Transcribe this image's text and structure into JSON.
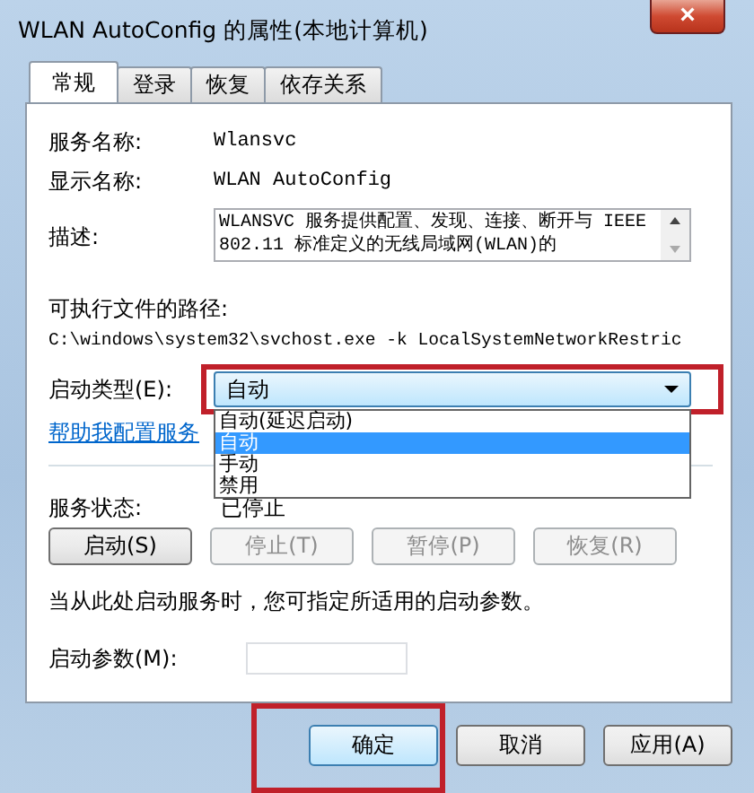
{
  "window": {
    "title": "WLAN AutoConfig 的属性(本地计算机)",
    "close": "×"
  },
  "tabs": [
    {
      "label": "常规",
      "selected": true
    },
    {
      "label": "登录",
      "selected": false
    },
    {
      "label": "恢复",
      "selected": false
    },
    {
      "label": "依存关系",
      "selected": false
    }
  ],
  "service_name": {
    "label": "服务名称:",
    "value": "Wlansvc"
  },
  "display_name": {
    "label": "显示名称:",
    "value": "WLAN AutoConfig"
  },
  "description": {
    "label": "描述:",
    "value": "WLANSVC 服务提供配置、发现、连接、断开与 IEEE 802.11 标准定义的无线局域网(WLAN)的"
  },
  "executable_path": {
    "label": "可执行文件的路径:",
    "value": "C:\\windows\\system32\\svchost.exe -k LocalSystemNetworkRestric"
  },
  "startup_type": {
    "label": "启动类型(E):",
    "value": "自动",
    "highlighted": true,
    "expanded": true,
    "options": [
      {
        "label": "自动(延迟启动)",
        "selected": false
      },
      {
        "label": "自动",
        "selected": true
      },
      {
        "label": "手动",
        "selected": false
      },
      {
        "label": "禁用",
        "selected": false
      }
    ]
  },
  "help_link": "帮助我配置服务",
  "service_status": {
    "label": "服务状态:",
    "value": "已停止"
  },
  "service_buttons": [
    {
      "label": "启动(S)",
      "disabled": false
    },
    {
      "label": "停止(T)",
      "disabled": true
    },
    {
      "label": "暂停(P)",
      "disabled": true
    },
    {
      "label": "恢复(R)",
      "disabled": true
    }
  ],
  "hint": "当从此处启动服务时，您可指定所适用的启动参数。",
  "start_parameters": {
    "label": "启动参数(M):"
  },
  "dialog_buttons": [
    {
      "label": "确定",
      "highlighted": true,
      "default": true
    },
    {
      "label": "取消",
      "highlighted": false,
      "default": false
    },
    {
      "label": "应用(A)",
      "highlighted": false,
      "default": false
    }
  ]
}
